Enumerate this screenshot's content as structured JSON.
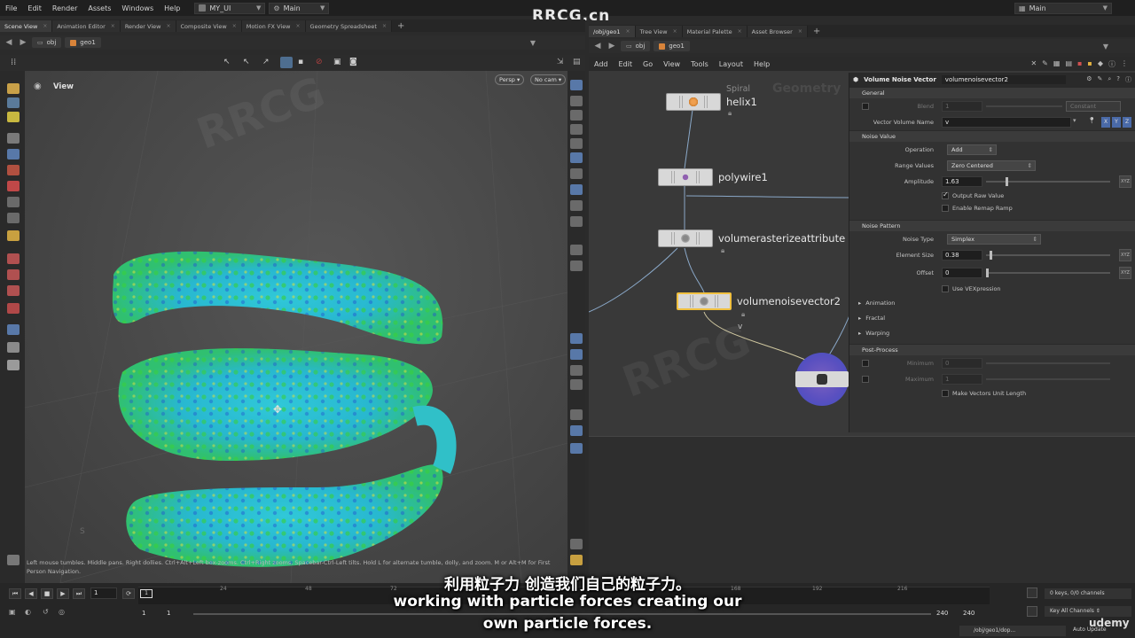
{
  "menubar": {
    "items": [
      "File",
      "Edit",
      "Render",
      "Assets",
      "Windows",
      "Help"
    ],
    "desktop": "MY_UI",
    "context": "Main",
    "right_context": "Main"
  },
  "brand": "RRCG.cn",
  "left_tabs": [
    "Scene View",
    "Animation Editor",
    "Render View",
    "Composite View",
    "Motion FX View",
    "Geometry Spreadsheet"
  ],
  "right_tabs": [
    "/obj/geo1",
    "Tree View",
    "Material Palette",
    "Asset Browser"
  ],
  "left_path": {
    "obj": "obj",
    "geo": "geo1"
  },
  "right_path": {
    "obj": "obj",
    "geo": "geo1"
  },
  "viewport": {
    "title": "View",
    "persp": "Persp",
    "cam": "No cam",
    "status": "Left mouse tumbles. Middle pans. Right dollies. Ctrl+Alt+Left box-zooms. Ctrl+Right zooms. Spacebar-Ctrl-Left tilts. Hold L for alternate tumble, dolly, and zoom.   M or Alt+M for First Person Navigation."
  },
  "network": {
    "menu": [
      "Add",
      "Edit",
      "Go",
      "View",
      "Tools",
      "Layout",
      "Help"
    ],
    "watermark_label": "Geometry",
    "nodes": [
      {
        "name": "helix1",
        "type": "Spiral"
      },
      {
        "name": "polywire1"
      },
      {
        "name": "volumerasterizeattribute"
      },
      {
        "name": "volumenoisevector2"
      }
    ],
    "wire_label": "v"
  },
  "params": {
    "node_type": "Volume Noise Vector",
    "node_name": "volumenoisevector2",
    "sections": {
      "general": "General",
      "noise_value": "Noise Value",
      "noise_pattern": "Noise Pattern",
      "post_process": "Post-Process"
    },
    "blend_label": "Blend",
    "blend_value": "1",
    "blend_mode": "Constant",
    "vector_volume_name_label": "Vector Volume Name",
    "vector_volume_name": "v",
    "operation_label": "Operation",
    "operation": "Add",
    "range_values_label": "Range Values",
    "range_values": "Zero Centered",
    "amplitude_label": "Amplitude",
    "amplitude": "1.63",
    "output_raw_value": "Output Raw Value",
    "enable_remap_ramp": "Enable Remap Ramp",
    "noise_type_label": "Noise Type",
    "noise_type": "Simplex",
    "element_size_label": "Element Size",
    "element_size": "0.38",
    "offset_label": "Offset",
    "offset": "0",
    "use_vexpression": "Use VEXpression",
    "animation": "Animation",
    "fractal": "Fractal",
    "warping": "Warping",
    "minimum_label": "Minimum",
    "minimum": "0",
    "maximum_label": "Maximum",
    "maximum": "1",
    "make_unit_length": "Make Vectors Unit Length",
    "xyz": "XYZ",
    "vec_buttons": [
      "X",
      "Y",
      "Z"
    ]
  },
  "timeline": {
    "frame": "1",
    "start": "1",
    "start2": "1",
    "end": "240",
    "end2": "240",
    "ticks": [
      "24",
      "48",
      "72",
      "168",
      "192",
      "216"
    ],
    "current_marker": "1",
    "keys": "0 keys, 0/0 channels",
    "key_all": "Key All Channels",
    "auto_update": "Auto Update",
    "path": "/obj/geo1/dop..."
  },
  "subtitles": {
    "cn": "利用粒子力  创造我们自己的粒子力。",
    "en1": "working with particle forces creating our",
    "en2": "own particle forces."
  },
  "udemy": "udemy"
}
